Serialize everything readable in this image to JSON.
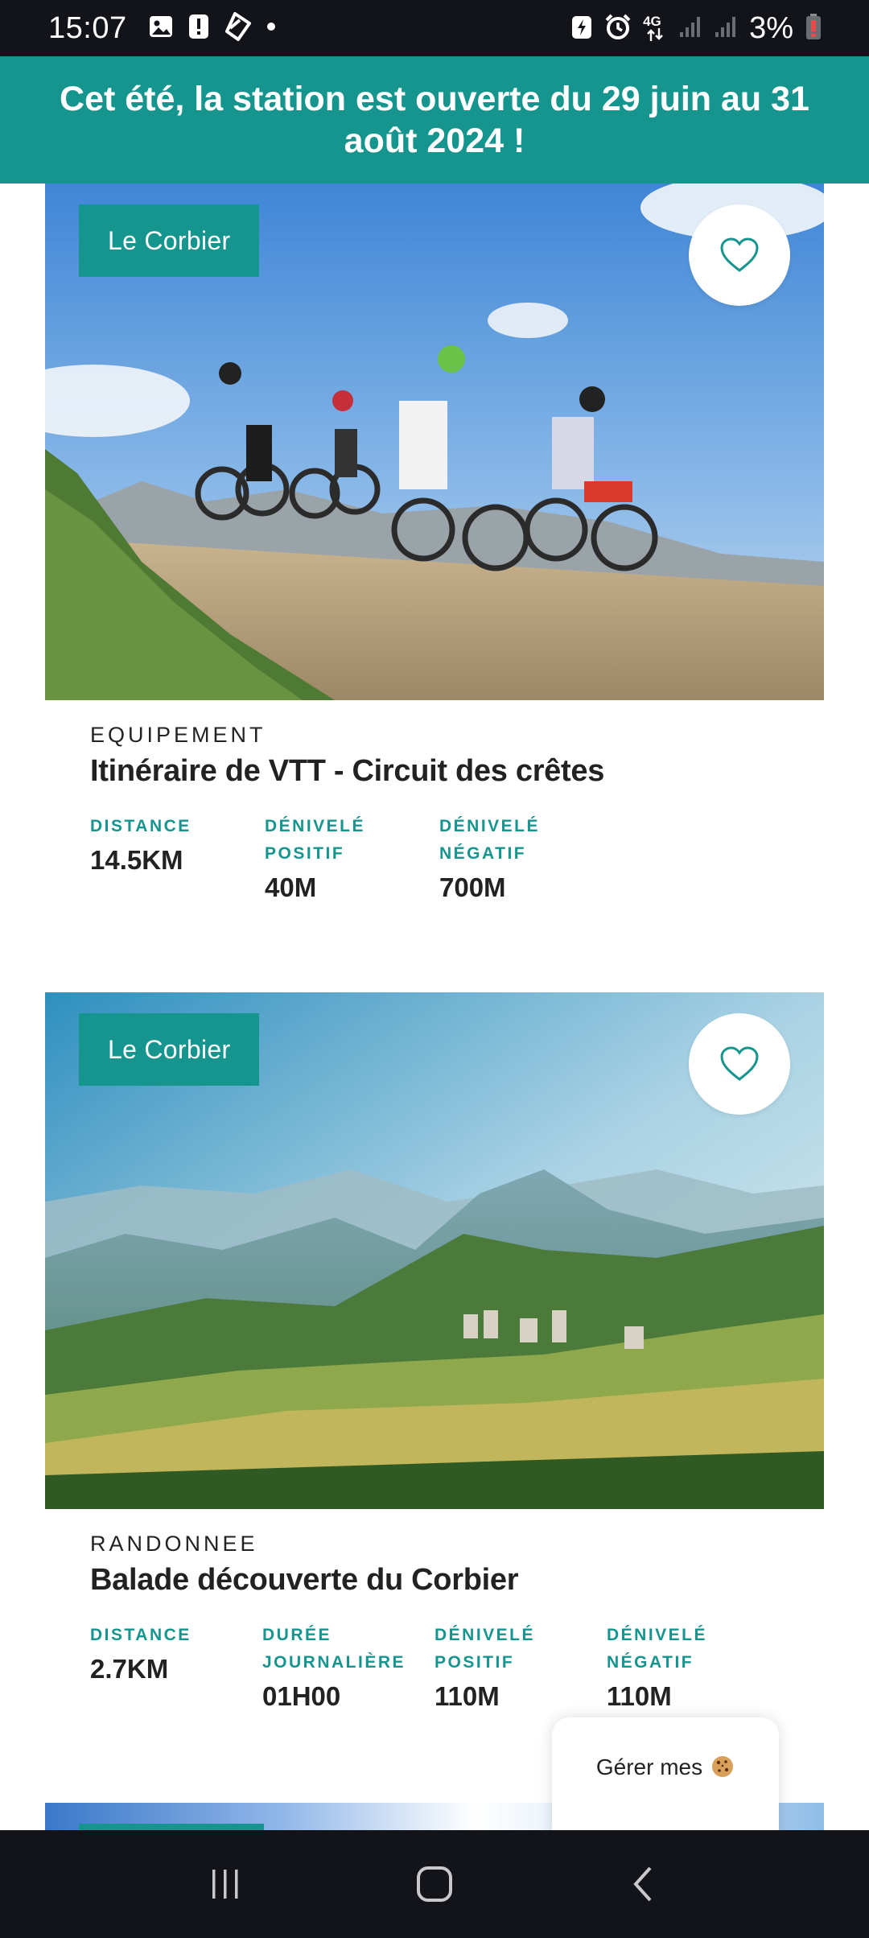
{
  "status_bar": {
    "time": "15:07",
    "battery": "3%",
    "network": "4G",
    "left_icons": [
      "image-icon",
      "alert-icon",
      "tag-icon",
      "dot-icon"
    ],
    "right_icons": [
      "battery-saver-icon",
      "alarm-icon",
      "signal-icon",
      "signal-icon",
      "battery-icon"
    ]
  },
  "banner": {
    "text": "Cet été, la station est ouverte du 29 juin au 31 août 2024 !",
    "color": "#16958f"
  },
  "cards": [
    {
      "location": "Le Corbier",
      "category": "EQUIPEMENT",
      "title": "Itinéraire de VTT - Circuit des crêtes",
      "stats": [
        {
          "label": "DISTANCE",
          "value": "14.5KM"
        },
        {
          "label": "DÉNIVELÉ POSITIF",
          "value": "40M"
        },
        {
          "label": "DÉNIVELÉ NÉGATIF",
          "value": "700M"
        }
      ]
    },
    {
      "location": "Le Corbier",
      "category": "RANDONNEE",
      "title": "Balade découverte du Corbier",
      "stats": [
        {
          "label": "DISTANCE",
          "value": "2.7KM"
        },
        {
          "label": "DURÉE JOURNALIÈRE",
          "value": "01H00"
        },
        {
          "label": "DÉNIVELÉ POSITIF",
          "value": "110M"
        },
        {
          "label": "DÉNIVELÉ NÉGATIF",
          "value": "110M"
        }
      ]
    }
  ],
  "cookie": {
    "label": "Gérer mes",
    "icon": "cookie-icon"
  },
  "nav": [
    "recent-apps-icon",
    "home-icon",
    "back-icon"
  ]
}
